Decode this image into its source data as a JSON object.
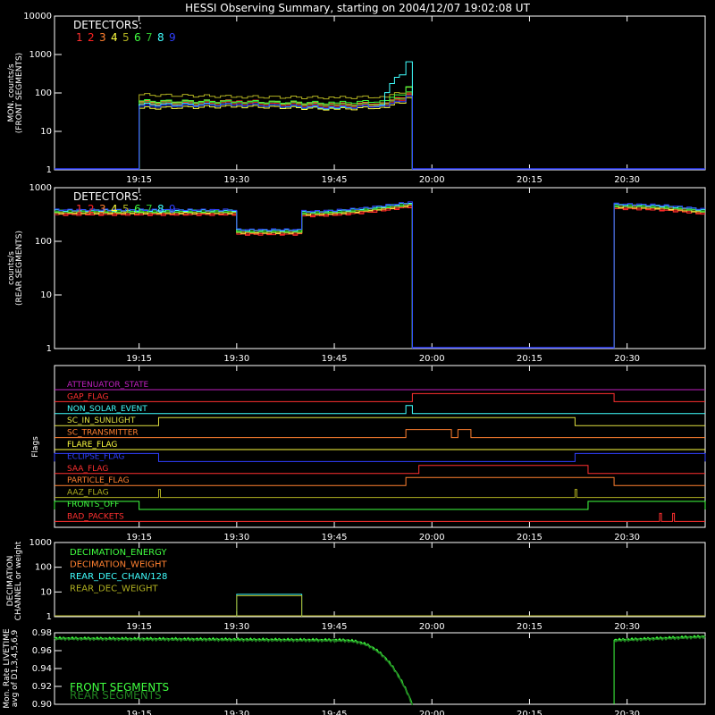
{
  "title": "HESSI Observing Summary, starting on 2004/12/07 19:02:08 UT",
  "time_axis": {
    "start": "19:02",
    "end": "20:42",
    "ticks": [
      "19:15",
      "19:30",
      "19:45",
      "20:00",
      "20:15",
      "20:30"
    ]
  },
  "detectors": {
    "header": "DETECTORS:",
    "items": [
      {
        "label": "1",
        "color": "#ff3030"
      },
      {
        "label": "2",
        "color": "#ff2020"
      },
      {
        "label": "3",
        "color": "#ff8030"
      },
      {
        "label": "4",
        "color": "#ffff40"
      },
      {
        "label": "5",
        "color": "#b0b020"
      },
      {
        "label": "6",
        "color": "#40ff40"
      },
      {
        "label": "7",
        "color": "#30c030"
      },
      {
        "label": "8",
        "color": "#40ffff"
      },
      {
        "label": "9",
        "color": "#3040ff"
      }
    ]
  },
  "chart_data": [
    {
      "type": "line",
      "panel": "front",
      "ylabel": [
        "MON. counts/s",
        "(FRONT SEGMENTS)"
      ],
      "yscale": "log",
      "ylim": [
        1,
        10000
      ],
      "yticks": [
        "10000",
        "1000",
        "100",
        "10",
        "1"
      ],
      "series": [
        {
          "detector": "1",
          "color": "#ff3030",
          "points": [
            [
              "19:15",
              60
            ],
            [
              "19:30",
              62
            ],
            [
              "19:45",
              50
            ],
            [
              "19:52",
              55
            ],
            [
              "19:55",
              70
            ],
            [
              "19:57",
              100
            ]
          ]
        },
        {
          "detector": "2",
          "color": "#ff2020",
          "points": [
            [
              "19:15",
              52
            ],
            [
              "19:30",
              55
            ],
            [
              "19:45",
              45
            ],
            [
              "19:52",
              50
            ],
            [
              "19:55",
              65
            ],
            [
              "19:57",
              90
            ]
          ]
        },
        {
          "detector": "3",
          "color": "#ff8030",
          "points": [
            [
              "19:15",
              58
            ],
            [
              "19:30",
              60
            ],
            [
              "19:45",
              50
            ],
            [
              "19:52",
              55
            ],
            [
              "19:55",
              75
            ],
            [
              "19:57",
              110
            ]
          ]
        },
        {
          "detector": "4",
          "color": "#ffff40",
          "points": [
            [
              "19:15",
              40
            ],
            [
              "19:30",
              45
            ],
            [
              "19:45",
              38
            ],
            [
              "19:52",
              42
            ],
            [
              "19:55",
              55
            ],
            [
              "19:57",
              85
            ]
          ]
        },
        {
          "detector": "5",
          "color": "#b0b020",
          "points": [
            [
              "19:15",
              90
            ],
            [
              "19:30",
              80
            ],
            [
              "19:45",
              75
            ],
            [
              "19:52",
              80
            ],
            [
              "19:55",
              100
            ],
            [
              "19:57",
              160
            ]
          ]
        },
        {
          "detector": "6",
          "color": "#40ff40",
          "points": [
            [
              "19:15",
              62
            ],
            [
              "19:30",
              60
            ],
            [
              "19:45",
              55
            ],
            [
              "19:52",
              62
            ],
            [
              "19:55",
              90
            ],
            [
              "19:57",
              180
            ]
          ]
        },
        {
          "detector": "7",
          "color": "#30c030",
          "points": [
            [
              "19:15",
              55
            ],
            [
              "19:30",
              58
            ],
            [
              "19:45",
              48
            ],
            [
              "19:52",
              52
            ],
            [
              "19:55",
              70
            ],
            [
              "19:57",
              130
            ]
          ]
        },
        {
          "detector": "8",
          "color": "#40ffff",
          "points": [
            [
              "19:15",
              50
            ],
            [
              "19:30",
              50
            ],
            [
              "19:45",
              40
            ],
            [
              "19:52",
              48
            ],
            [
              "19:55",
              300
            ],
            [
              "19:57",
              900
            ]
          ]
        },
        {
          "detector": "9",
          "color": "#3040ff",
          "points": [
            [
              "19:15",
              45
            ],
            [
              "19:30",
              50
            ],
            [
              "19:45",
              42
            ],
            [
              "19:52",
              46
            ],
            [
              "19:55",
              60
            ],
            [
              "19:57",
              95
            ]
          ]
        }
      ],
      "active_interval": [
        "19:15",
        "19:57"
      ]
    },
    {
      "type": "line",
      "panel": "rear",
      "ylabel": [
        "counts/s",
        "(REAR SEGMENTS)"
      ],
      "yscale": "log",
      "ylim": [
        1,
        1000
      ],
      "yticks": [
        "1000",
        "100",
        "10",
        "1"
      ],
      "segments": [
        {
          "from": "19:02",
          "to": "19:30",
          "level": 350
        },
        {
          "from": "19:30",
          "to": "19:40",
          "level": 150
        },
        {
          "from": "19:40",
          "to": "19:57",
          "level": 330,
          "end_level": 500
        },
        {
          "from": "20:28",
          "to": "20:42",
          "level": 450,
          "end_level": 350
        }
      ],
      "gap_interval": [
        "19:57",
        "20:28"
      ]
    },
    {
      "type": "timeline",
      "panel": "flags",
      "ylabel": "Flags",
      "flags": [
        {
          "name": "ATTENUATOR_STATE",
          "color": "#c020c0",
          "on": []
        },
        {
          "name": "GAP_FLAG",
          "color": "#ff3030",
          "on": [
            [
              "19:57",
              "20:28"
            ]
          ]
        },
        {
          "name": "NON_SOLAR_EVENT",
          "color": "#40ffff",
          "on": [
            [
              "19:56",
              "19:57"
            ]
          ]
        },
        {
          "name": "SC_IN_SUNLIGHT",
          "color": "#e0e040",
          "on": [
            [
              "19:18",
              "20:22"
            ]
          ]
        },
        {
          "name": "SC_TRANSMITTER",
          "color": "#ff8030",
          "on": [
            [
              "19:56",
              "20:03"
            ],
            [
              "20:04",
              "20:06"
            ]
          ]
        },
        {
          "name": "FLARE_FLAG",
          "color": "#ffff40",
          "on": []
        },
        {
          "name": "ECLIPSE_FLAG",
          "color": "#3040ff",
          "on": [
            [
              "19:02",
              "19:18"
            ],
            [
              "20:22",
              "20:42"
            ]
          ]
        },
        {
          "name": "SAA_FLAG",
          "color": "#ff3030",
          "on": [
            [
              "19:58",
              "20:24"
            ]
          ]
        },
        {
          "name": "PARTICLE_FLAG",
          "color": "#ff8030",
          "on": [
            [
              "19:56",
              "20:28"
            ]
          ]
        },
        {
          "name": "AAZ_FLAG",
          "color": "#b0b020",
          "on": [
            [
              "19:18",
              "19:18"
            ],
            [
              "20:22",
              "20:22"
            ]
          ]
        },
        {
          "name": "FRONTS_OFF",
          "color": "#40ff40",
          "on": [
            [
              "19:02",
              "19:15"
            ],
            [
              "20:24",
              "20:42"
            ]
          ]
        },
        {
          "name": "BAD_PACKETS",
          "color": "#ff3030",
          "on": [
            [
              "20:35",
              "20:35"
            ],
            [
              "20:37",
              "20:37"
            ]
          ]
        }
      ]
    },
    {
      "type": "line",
      "panel": "decimation",
      "ylabel": [
        "DECIMATION",
        "CHANNEL or weight"
      ],
      "yscale": "log",
      "ylim": [
        1,
        1000
      ],
      "yticks": [
        "1000",
        "100",
        "10",
        "1"
      ],
      "legend": [
        {
          "name": "DECIMATION_ENERGY",
          "color": "#40ff40"
        },
        {
          "name": "DECIMATION_WEIGHT",
          "color": "#ff8030"
        },
        {
          "name": "REAR_DEC_CHAN/128",
          "color": "#40ffff"
        },
        {
          "name": "REAR_DEC_WEIGHT",
          "color": "#b0b020"
        }
      ],
      "steps": [
        {
          "series": "REAR_DEC_CHAN/128",
          "from": "19:30",
          "to": "19:40",
          "value": 8
        },
        {
          "series": "REAR_DEC_WEIGHT",
          "from": "19:30",
          "to": "19:40",
          "value": 7
        }
      ]
    },
    {
      "type": "line",
      "panel": "livetime",
      "ylabel": [
        "Mon. Rate LIVETIME",
        "avg of D1,3,4,5,6,9"
      ],
      "ylim": [
        0.9,
        0.98
      ],
      "yticks": [
        "0.98",
        "0.96",
        "0.94",
        "0.92",
        "0.90"
      ],
      "legend": [
        {
          "name": "FRONT SEGMENTS",
          "color": "#40ff40"
        },
        {
          "name": "REAR SEGMENTS",
          "color": "#208020"
        }
      ],
      "segments": [
        {
          "from": "19:02",
          "to": "19:45",
          "start": 0.974,
          "end": 0.972
        },
        {
          "from": "19:45",
          "to": "19:57",
          "start": 0.972,
          "end": 0.9
        },
        {
          "from": "20:28",
          "to": "20:42",
          "start": 0.972,
          "end": 0.976
        }
      ]
    }
  ]
}
